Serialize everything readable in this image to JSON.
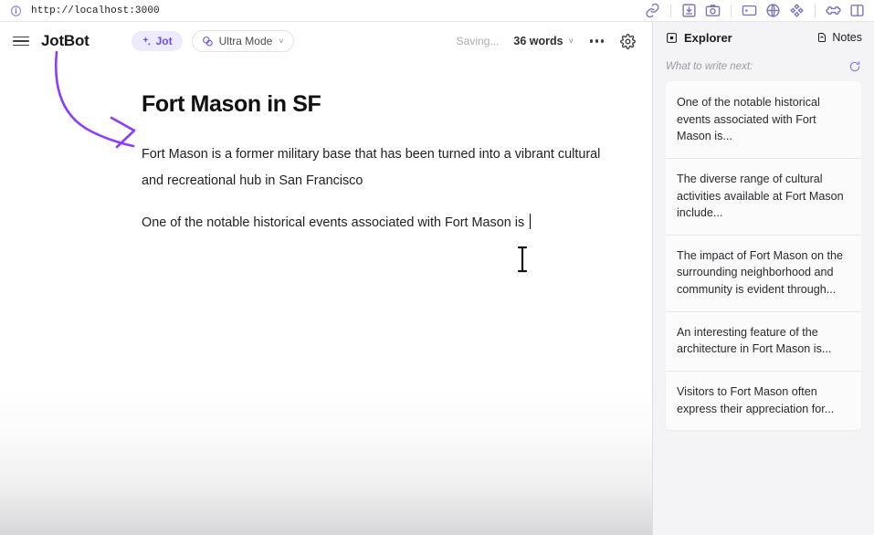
{
  "browser": {
    "info_icon": "info-icon",
    "url": "http://localhost:3000",
    "extension_icons": [
      "link-icon",
      "save-image-icon",
      "camera-icon",
      "window-icon",
      "globe-icon",
      "target-icon",
      "puzzle-icon",
      "sidebar-panel-icon"
    ]
  },
  "header": {
    "menu_icon": "hamburger-menu-icon",
    "brand": "JotBot",
    "jot_button": {
      "label": "Jot",
      "icon": "sparkle-icon",
      "accent": "#6d4df6",
      "background": "#eeeaff"
    },
    "ultra_mode_button": {
      "label": "Ultra Mode",
      "icon": "shapes-icon",
      "chevron": "˅"
    },
    "saving_status": "Saving...",
    "word_count": "36 words",
    "word_count_chevron": "˅",
    "more_menu_icon": "ellipsis-icon",
    "settings_icon": "gear-icon"
  },
  "document": {
    "title": "Fort Mason in SF",
    "paragraphs": [
      "Fort Mason is a former military base that has been turned into a vibrant cultural and recreational hub in San Francisco",
      "One of the notable historical events associated with Fort Mason is "
    ],
    "cursor": "text-caret"
  },
  "annotation": {
    "type": "curved-arrow",
    "color": "#8b3dff",
    "points_to": "document-title"
  },
  "sidebar": {
    "title": "Explorer",
    "title_icon": "explorer-panel-icon",
    "notes_button": {
      "label": "Notes",
      "icon": "note-file-icon"
    },
    "subhead": "What to write next:",
    "refresh_icon": "refresh-icon",
    "refresh_color": "#8b7ae0",
    "suggestions": [
      "One of the notable historical events associated with Fort Mason is...",
      "The diverse range of cultural activities available at Fort Mason include...",
      "The impact of Fort Mason on the surrounding neighborhood and community is evident through...",
      "An interesting feature of the architecture in Fort Mason is...",
      "Visitors to Fort Mason often express their appreciation for..."
    ]
  }
}
